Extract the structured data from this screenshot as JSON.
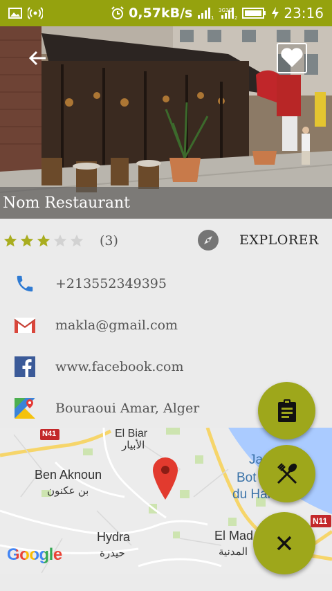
{
  "status_bar": {
    "speed": "0,57kB/s",
    "time": "23:16",
    "icons": [
      "image-icon",
      "hotspot-icon",
      "alarm-icon",
      "signal-1-icon",
      "signal-2-icon",
      "battery-icon",
      "charging-icon"
    ]
  },
  "hero": {
    "title": "Nom Restaurant"
  },
  "rating": {
    "stars": 3,
    "max": 5,
    "count": "(3)"
  },
  "explore": {
    "label": "EXPLORER"
  },
  "contacts": [
    {
      "icon": "phone-icon",
      "text": "+213552349395"
    },
    {
      "icon": "gmail-icon",
      "text": "makla@gmail.com"
    },
    {
      "icon": "facebook-icon",
      "text": "www.facebook.com"
    },
    {
      "icon": "maps-icon",
      "text": "Bouraoui Amar, Alger"
    }
  ],
  "map": {
    "labels": {
      "el_biar": "El Biar",
      "el_biar_ar": "الأبيار",
      "ben_aknoun": "Ben Aknoun",
      "ben_aknoun_ar": "بن عكنون",
      "hydra": "Hydra",
      "hydra_ar": "حيدرة",
      "el_mad": "El Mad",
      "el_mad_ar": "المدنية",
      "jardin_1": "Ja",
      "jardin_2": "Bot",
      "jardin_3": "du Ham",
      "road_n41": "N41",
      "road_n11": "N11",
      "logo": "Google"
    }
  },
  "fabs": [
    {
      "icon": "clipboard-icon"
    },
    {
      "icon": "restaurant-icon"
    },
    {
      "icon": "close-icon"
    }
  ],
  "colors": {
    "accent": "#95a20e",
    "fab": "#9ea71b",
    "star_filled": "#a9ad1f",
    "star_empty": "#d2d2d2"
  }
}
